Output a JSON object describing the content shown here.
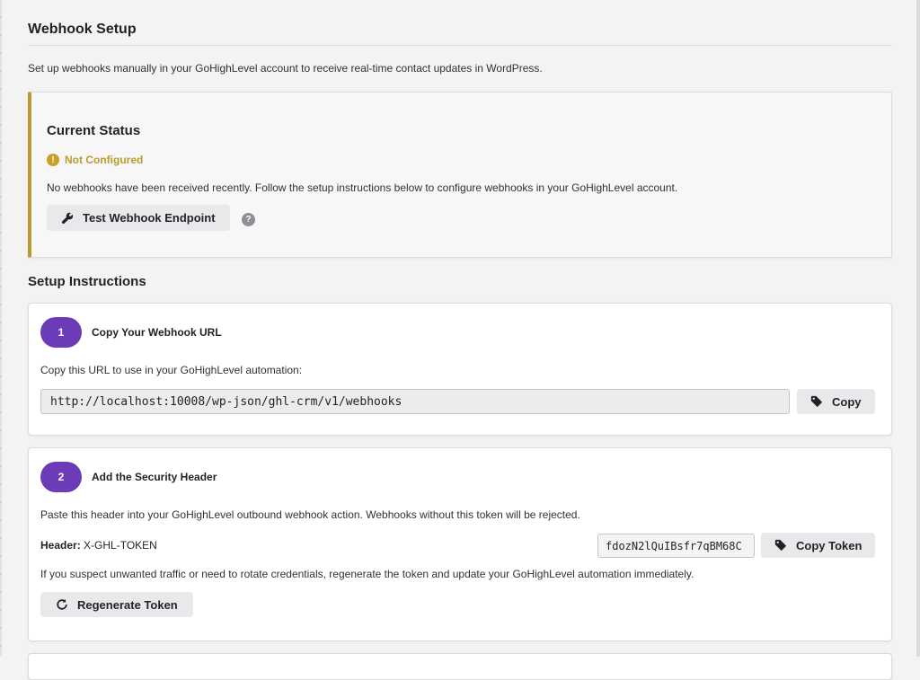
{
  "page": {
    "title": "Webhook Setup",
    "description": "Set up webhooks manually in your GoHighLevel account to receive real-time contact updates in WordPress."
  },
  "status": {
    "title": "Current Status",
    "badge": "Not Configured",
    "badge_icon": "!",
    "description": "No webhooks have been received recently. Follow the setup instructions below to configure webhooks in your GoHighLevel account.",
    "test_button": "Test Webhook Endpoint",
    "help_icon": "?"
  },
  "instructions": {
    "title": "Setup Instructions",
    "step1": {
      "number": "1",
      "title": "Copy Your Webhook URL",
      "text": "Copy this URL to use in your GoHighLevel automation:",
      "url": "http://localhost:10008/wp-json/ghl-crm/v1/webhooks",
      "copy_button": "Copy"
    },
    "step2": {
      "number": "2",
      "title": "Add the Security Header",
      "text": "Paste this header into your GoHighLevel outbound webhook action. Webhooks without this token will be rejected.",
      "header_label": "Header:",
      "header_name": "X-GHL-TOKEN",
      "token": "fdozN2lQuIBsfr7qBM68C",
      "copy_token_button": "Copy Token",
      "rotate_text": "If you suspect unwanted traffic or need to rotate credentials, regenerate the token and update your GoHighLevel automation immediately.",
      "regenerate_button": "Regenerate Token"
    }
  },
  "colors": {
    "accent_purple": "#6b3bb8",
    "warning": "#b89b2e"
  }
}
